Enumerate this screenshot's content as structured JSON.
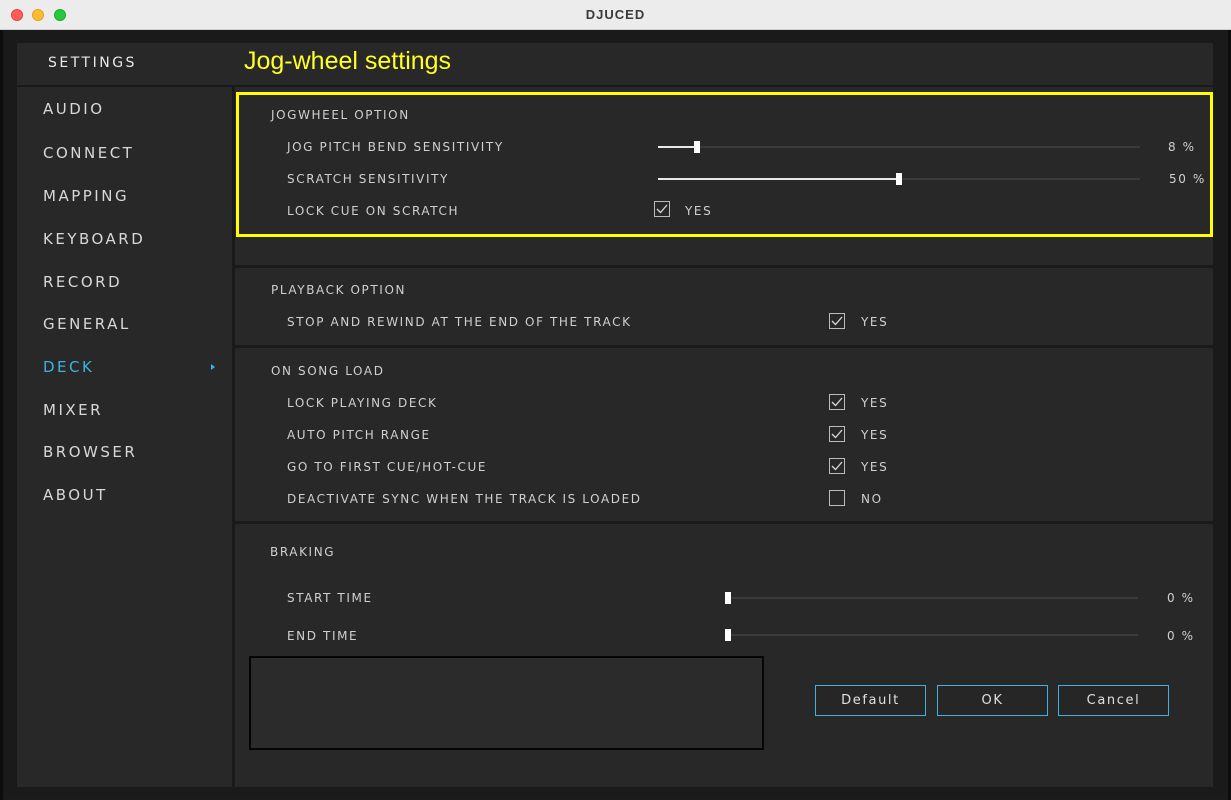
{
  "window": {
    "title": "DJUCED"
  },
  "header": {
    "settings_label": "SETTINGS",
    "page_title": "Jog-wheel settings"
  },
  "sidebar": {
    "items": [
      {
        "label": "AUDIO",
        "active": false
      },
      {
        "label": "CONNECT",
        "active": false
      },
      {
        "label": "MAPPING",
        "active": false
      },
      {
        "label": "KEYBOARD",
        "active": false
      },
      {
        "label": "RECORD",
        "active": false
      },
      {
        "label": "GENERAL",
        "active": false
      },
      {
        "label": "DECK",
        "active": true
      },
      {
        "label": "MIXER",
        "active": false
      },
      {
        "label": "BROWSER",
        "active": false
      },
      {
        "label": "ABOUT",
        "active": false
      }
    ]
  },
  "jogwheel": {
    "heading": "JOGWHEEL OPTION",
    "pitch_bend": {
      "label": "JOG PITCH BEND SENSITIVITY",
      "value": 8,
      "value_text": "8 %"
    },
    "scratch": {
      "label": "SCRATCH SENSITIVITY",
      "value": 50,
      "value_text": "50 %"
    },
    "lock_cue": {
      "label": "LOCK CUE ON SCRATCH",
      "checked": true,
      "value_text": "YES"
    }
  },
  "playback": {
    "heading": "PLAYBACK OPTION",
    "stop_rewind": {
      "label": "STOP AND REWIND AT THE END OF THE TRACK",
      "checked": true,
      "value_text": "YES"
    }
  },
  "song_load": {
    "heading": "ON SONG LOAD",
    "lock_playing": {
      "label": "LOCK PLAYING DECK",
      "checked": true,
      "value_text": "YES"
    },
    "auto_pitch": {
      "label": "AUTO PITCH RANGE",
      "checked": true,
      "value_text": "YES"
    },
    "first_cue": {
      "label": "GO TO FIRST CUE/HOT-CUE",
      "checked": true,
      "value_text": "YES"
    },
    "deactivate_sync": {
      "label": "DEACTIVATE SYNC WHEN THE TRACK IS LOADED",
      "checked": false,
      "value_text": "NO"
    }
  },
  "braking": {
    "heading": "BRAKING",
    "start_time": {
      "label": "START TIME",
      "value": 0,
      "value_text": "0 %"
    },
    "end_time": {
      "label": "END TIME",
      "value": 0,
      "value_text": "0 %"
    }
  },
  "buttons": {
    "default": "Default",
    "ok": "OK",
    "cancel": "Cancel"
  },
  "colors": {
    "accent": "#3db4de",
    "highlight": "#ffff00",
    "panel": "#282828"
  }
}
